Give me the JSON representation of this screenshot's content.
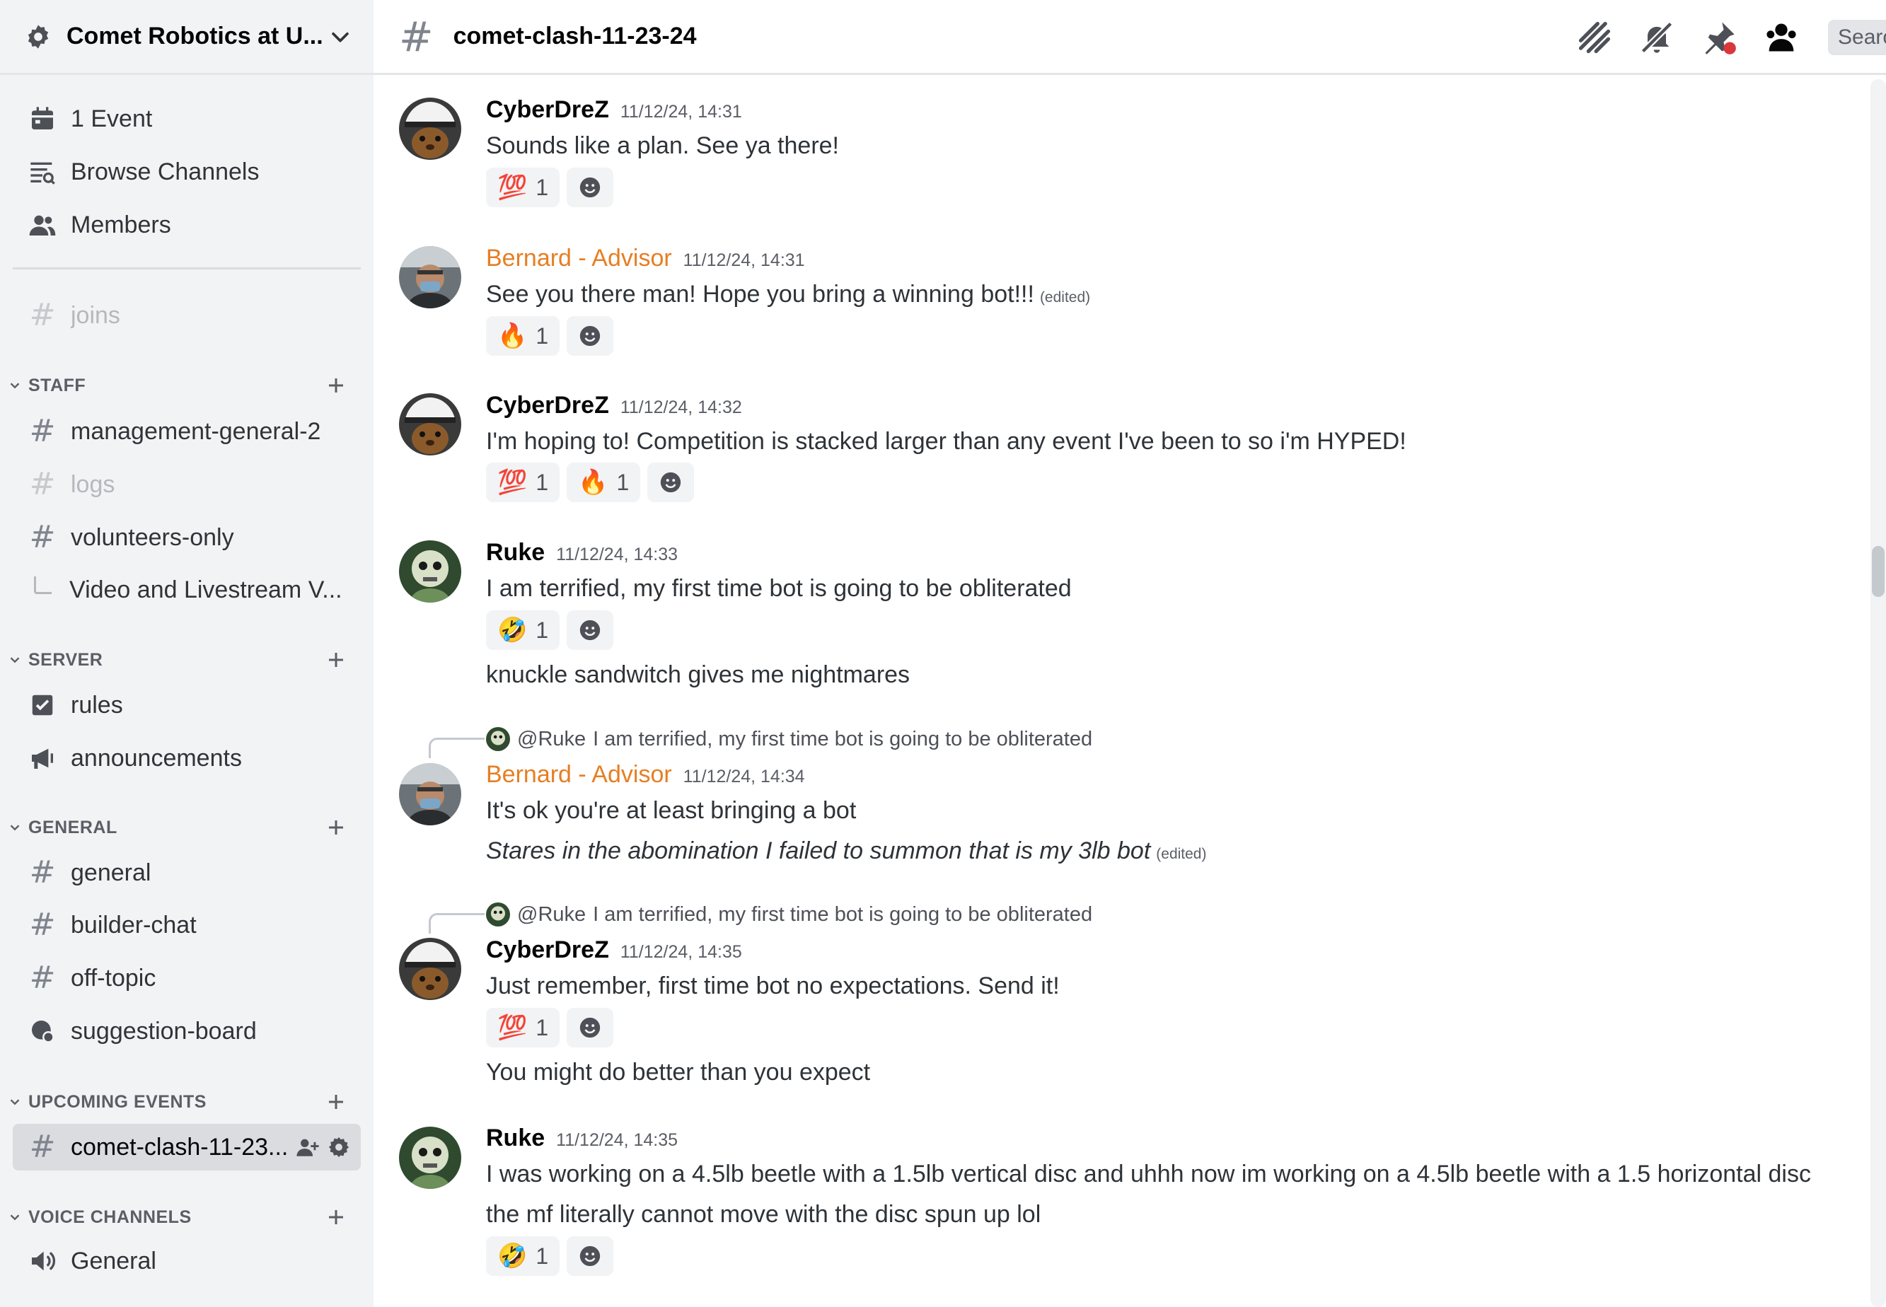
{
  "server": {
    "name": "Comet Robotics at U..."
  },
  "sidebar": {
    "top_items": [
      {
        "label": "1 Event"
      },
      {
        "label": "Browse Channels"
      },
      {
        "label": "Members"
      }
    ],
    "joins": "joins",
    "categories": {
      "staff": "STAFF",
      "server": "SERVER",
      "general": "GENERAL",
      "upcoming": "UPCOMING EVENTS",
      "voice": "VOICE CHANNELS"
    },
    "staff_channels": [
      "management-general-2",
      "logs",
      "volunteers-only"
    ],
    "thread": "Video and Livestream V...",
    "server_channels": [
      "rules",
      "announcements"
    ],
    "general_channels": [
      "general",
      "builder-chat",
      "off-topic",
      "suggestion-board"
    ],
    "upcoming_channel": "comet-clash-11-23...",
    "voice_channel": "General"
  },
  "header": {
    "channel": "comet-clash-11-23-24",
    "search_placeholder": "Search"
  },
  "messages": [
    {
      "author": "CyberDreZ",
      "timestamp": "11/12/24, 14:31",
      "text": "Sounds like a plan. See ya there!",
      "reactions": [
        {
          "emoji": "💯",
          "count": "1"
        }
      ]
    },
    {
      "author": "Bernard - Advisor",
      "timestamp": "11/12/24, 14:31",
      "text": "See you there man! Hope you bring a winning bot!!!",
      "edited": "(edited)",
      "reactions": [
        {
          "emoji": "🔥",
          "count": "1"
        }
      ]
    },
    {
      "author": "CyberDreZ",
      "timestamp": "11/12/24, 14:32",
      "text": "I'm hoping to! Competition is stacked larger than any event I've been to so i'm HYPED!",
      "reactions": [
        {
          "emoji": "💯",
          "count": "1"
        },
        {
          "emoji": "🔥",
          "count": "1"
        }
      ]
    },
    {
      "author": "Ruke",
      "timestamp": "11/12/24, 14:33",
      "text": "I am terrified, my first time bot is going to be obliterated",
      "reactions": [
        {
          "emoji": "🤣",
          "count": "1"
        }
      ],
      "followup": "knuckle sandwitch gives me nightmares"
    },
    {
      "reply_to": "@Ruke",
      "reply_text": "I am terrified, my first time bot is going to be obliterated",
      "author": "Bernard - Advisor",
      "timestamp": "11/12/24, 14:34",
      "text": "It's ok you're at least bringing a bot",
      "followup": "Stares in the abomination I failed to summon that is my 3lb bot",
      "edited": "(edited)"
    },
    {
      "reply_to": "@Ruke",
      "reply_text": "I am terrified, my first time bot is going to be obliterated",
      "author": "CyberDreZ",
      "timestamp": "11/12/24, 14:35",
      "text": "Just remember, first time bot no expectations.  Send it!",
      "reactions": [
        {
          "emoji": "💯",
          "count": "1"
        }
      ],
      "followup": "You might do better than you expect"
    },
    {
      "author": "Ruke",
      "timestamp": "11/12/24, 14:35",
      "text": "I was working on a 4.5lb beetle with a 1.5lb vertical disc and uhhh now im working on a 4.5lb beetle with a 1.5 horizontal disc",
      "followup": "the mf literally cannot move with the disc spun up lol",
      "reactions": [
        {
          "emoji": "🤣",
          "count": "1"
        }
      ]
    }
  ],
  "colors": {
    "advisor": "#e67e22",
    "sidebar_bg": "#f2f3f5",
    "selected_bg": "#dadce0",
    "notification_dot": "#da373c"
  }
}
